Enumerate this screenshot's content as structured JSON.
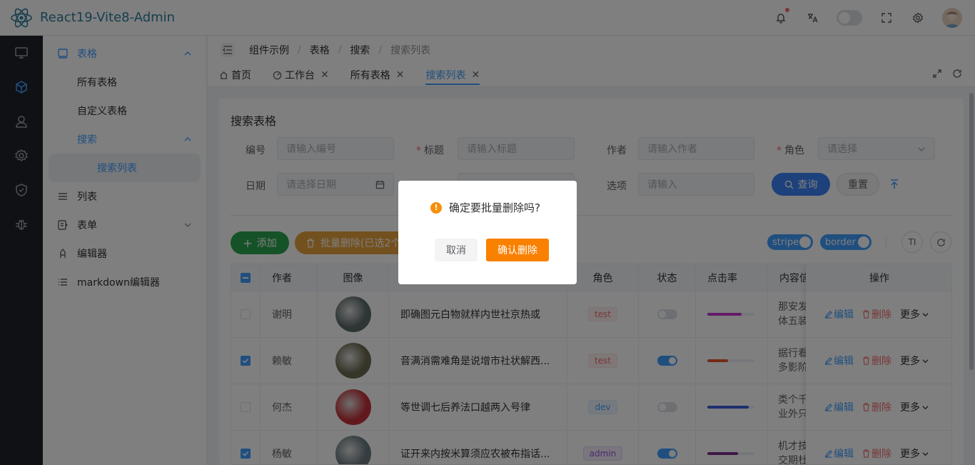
{
  "app": {
    "title": "React19-Vite8-Admin"
  },
  "header": {
    "icons": [
      "bell-icon",
      "translate-icon",
      "theme-toggle",
      "fullscreen-icon",
      "settings-icon",
      "avatar"
    ]
  },
  "rail": {
    "icons": [
      "monitor-icon",
      "cube-icon",
      "user-icon",
      "gear-icon",
      "shield-icon",
      "bug-icon"
    ]
  },
  "sidebar": {
    "items": [
      {
        "label": "表格",
        "icon": "table-icon"
      },
      {
        "label": "所有表格"
      },
      {
        "label": "自定义表格"
      },
      {
        "label": "搜索"
      },
      {
        "label": "搜索列表"
      },
      {
        "label": "列表",
        "icon": "list-icon"
      },
      {
        "label": "表单",
        "icon": "form-icon"
      },
      {
        "label": "编辑器",
        "icon": "editor-icon"
      },
      {
        "label": "markdown编辑器",
        "icon": "markdown-icon"
      }
    ]
  },
  "breadcrumb": [
    "组件示例",
    "表格",
    "搜索",
    "搜索列表"
  ],
  "tabs": [
    {
      "label": "首页"
    },
    {
      "label": "工作台"
    },
    {
      "label": "所有表格"
    },
    {
      "label": "搜索列表"
    }
  ],
  "card": {
    "title": "搜索表格"
  },
  "form": {
    "id_label": "编号",
    "id_placeholder": "请输入编号",
    "title_label": "标题",
    "title_placeholder": "请输入标题",
    "author_label": "作者",
    "author_placeholder": "请输入作者",
    "role_label": "角色",
    "role_placeholder": "请选择",
    "date_label": "日期",
    "date_placeholder": "请选择日期",
    "option_label": "选项",
    "option_placeholder": "请输入",
    "query_label": "查询",
    "reset_label": "重置"
  },
  "toolbar": {
    "add_label": "添加",
    "batch_delete_label": "批量删除(已选2个)",
    "stripe_label": "stripe",
    "border_label": "border"
  },
  "table": {
    "headers": {
      "author": "作者",
      "image": "图像",
      "role": "角色",
      "status": "状态",
      "click": "点击率",
      "content": "内容信",
      "actions": "操作"
    },
    "rows": [
      {
        "checked": false,
        "author": "谢明",
        "title": "即确图元白物就样内世社京热或",
        "role": "test",
        "status": false,
        "click_rate": 0.72,
        "bar_color": "#c936d1",
        "content": [
          "那安发",
          "体五装"
        ]
      },
      {
        "checked": true,
        "author": "赖敏",
        "title": "音满消需难角是说增市社状解西...",
        "role": "test",
        "status": true,
        "click_rate": 0.44,
        "bar_color": "#e8542d",
        "content": [
          "据行看",
          "多影阶"
        ]
      },
      {
        "checked": false,
        "author": "何杰",
        "title": "等世调七后养法口越两入号律",
        "role": "dev",
        "status": false,
        "click_rate": 0.88,
        "bar_color": "#3d5fe0",
        "content": [
          "类个千",
          "业外只"
        ]
      },
      {
        "checked": true,
        "author": "杨敏",
        "title": "证开来内按米算须应农被布指话...",
        "role": "admin",
        "status": true,
        "click_rate": 0.65,
        "bar_color": "#7b2f8f",
        "content": [
          "机才技",
          "交期杜"
        ]
      }
    ],
    "row_actions": {
      "edit": "编辑",
      "delete": "删除",
      "more": "更多"
    }
  },
  "dialog": {
    "message": "确定要批量删除吗?",
    "cancel_label": "取消",
    "confirm_label": "确认删除"
  },
  "colors": {
    "primary": "#409eff",
    "success": "#2aa54f",
    "warning": "#fa8000",
    "danger": "#f56c6c"
  }
}
